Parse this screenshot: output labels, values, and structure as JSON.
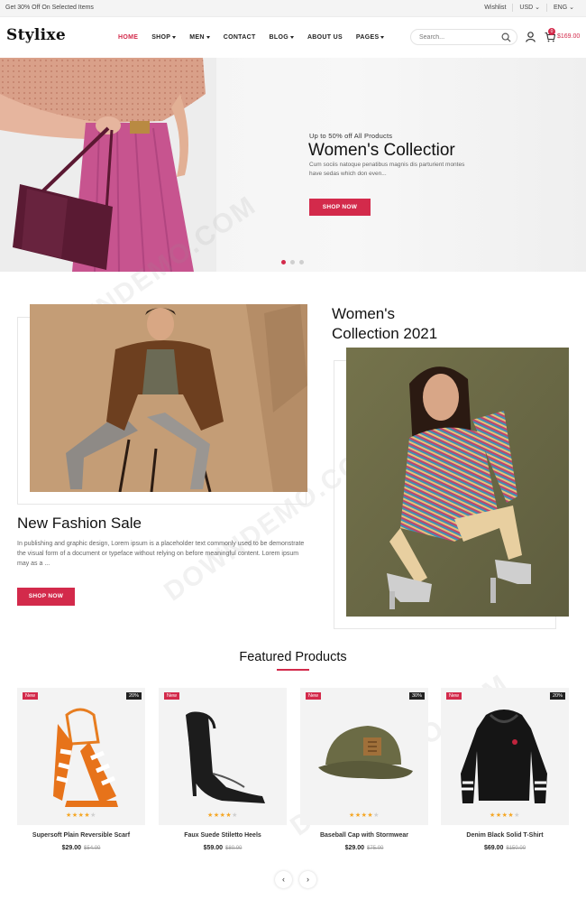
{
  "topbar": {
    "promo": "Get 30% Off On Selected Items",
    "wishlist": "Wishlist",
    "currency": "USD",
    "language": "ENG"
  },
  "header": {
    "logo": "Stylixe",
    "nav": [
      {
        "label": "HOME",
        "active": true,
        "dropdown": false
      },
      {
        "label": "SHOP",
        "active": false,
        "dropdown": true
      },
      {
        "label": "MEN",
        "active": false,
        "dropdown": true
      },
      {
        "label": "CONTACT",
        "active": false,
        "dropdown": false
      },
      {
        "label": "BLOG",
        "active": false,
        "dropdown": true
      },
      {
        "label": "ABOUT US",
        "active": false,
        "dropdown": false
      },
      {
        "label": "PAGES",
        "active": false,
        "dropdown": true
      }
    ],
    "search_placeholder": "Search...",
    "cart_count": "0",
    "cart_total": "$169.00"
  },
  "hero": {
    "subtitle": "Up to 50% off All Products",
    "title": "Women's Collectior",
    "description": "Cum sociis natoque penatibus magnis dis parturient montes have sedas which don even...",
    "button": "SHOP NOW",
    "slides": 3,
    "active_slide": 1
  },
  "collection": {
    "sale_title": "New Fashion Sale",
    "sale_description": "In publishing and graphic design, Lorem ipsum is a placeholder text commonly used to be demonstrate the visual form of a document or typeface without relying on before meaningful content. Lorem ipsum may as a ...",
    "sale_button": "SHOP NOW",
    "women_title_line1": "Women's",
    "women_title_line2": "Collection 2021"
  },
  "featured": {
    "title": "Featured Products",
    "products": [
      {
        "badge_new": "New",
        "badge_discount": "20%",
        "rating": 4,
        "name": "Supersoft Plain Reversible Scarf",
        "price": "$29.00",
        "old_price": "$54.00"
      },
      {
        "badge_new": "New",
        "badge_discount": "",
        "rating": 4,
        "name": "Faux Suede Stiletto Heels",
        "price": "$59.00",
        "old_price": "$80.00"
      },
      {
        "badge_new": "New",
        "badge_discount": "30%",
        "rating": 4,
        "name": "Baseball Cap with Stormwear",
        "price": "$29.00",
        "old_price": "$75.00"
      },
      {
        "badge_new": "New",
        "badge_discount": "20%",
        "rating": 4,
        "name": "Denim Black Solid T-Shirt",
        "price": "$69.00",
        "old_price": "$150.00"
      }
    ],
    "prev_label": "‹",
    "next_label": "›"
  },
  "colors": {
    "accent": "#d32a4b",
    "text": "#222222",
    "muted": "#666666"
  }
}
